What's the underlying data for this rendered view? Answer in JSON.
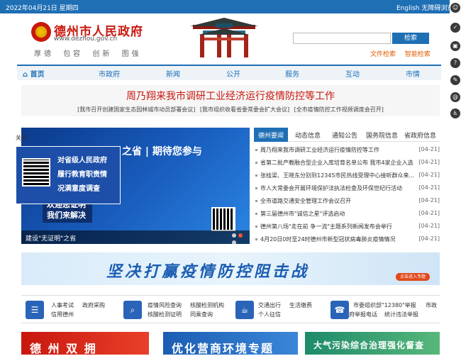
{
  "topbar": {
    "date": "2022年04月21日 星期四",
    "lang": "English",
    "access": "无障碍浏览"
  },
  "header": {
    "title": "德州市人民政府",
    "url": "www.dezhou.gov.cn",
    "slogans": [
      "厚德",
      "包容",
      "创新",
      "图强"
    ],
    "search_placeholder": "",
    "search_button": "检索",
    "links": [
      "文件检索",
      "智能检索"
    ]
  },
  "nav": [
    "首页",
    "市政府",
    "新闻",
    "公开",
    "服务",
    "互动",
    "市情"
  ],
  "headline": {
    "title": "周乃翔来我市调研工业经济运行疫情防控等工作",
    "subs": [
      "[我市召开创建国家生态园林城市动员部署会议]",
      "[我市组织收看省委常委会扩大会议]",
      "[全市疫情防控工作视频调度会召开]"
    ]
  },
  "slider": {
    "bigtext": "之省 | 期待您参与",
    "button_text": [
      "欢迎您证明",
      "我们来解决"
    ],
    "caption": "建设\"无证明\"之省",
    "arrow": "›"
  },
  "popup": {
    "lines": [
      "对省级人民政府",
      "履行教育职责情",
      "况满意度调查"
    ],
    "close": "关闭"
  },
  "news": {
    "tabs": [
      "德州要闻",
      "动态信息",
      "通知公告",
      "国务院信息",
      "省政府信息"
    ],
    "items": [
      {
        "title": "周乃翔来我市调研工业经济运行疫情防控等工作",
        "date": "[04-21]"
      },
      {
        "title": "省第二批产教融合型企业入库培育名单公布 我市4家企业入选",
        "date": "[04-21]"
      },
      {
        "title": "张桂梁、王晓东分别到12345市民热线受理中心接听群众来...",
        "date": "[04-21]"
      },
      {
        "title": "市人大常委会开展环境保护法执法检查及环保世纪行活动",
        "date": "[04-21]"
      },
      {
        "title": "全市道路交通安全管理工作会议召开",
        "date": "[04-21]"
      },
      {
        "title": "第三届德州市\"诚信之星\"评选启动",
        "date": "[04-21]"
      },
      {
        "title": "德州第八场\"走在前 争一流\"主题系列新闻发布会举行",
        "date": "[04-21]"
      },
      {
        "title": "4月20日0时至24时德州市新型冠状病毒肺炎疫情情况",
        "date": "[04-21]"
      }
    ]
  },
  "banner": {
    "text": "坚决打赢疫情防控阻击战",
    "pill": "点击进入专题"
  },
  "services": [
    {
      "icon": "list-icon",
      "glyph": "☰",
      "rows": [
        [
          "人事考试",
          "政府采购"
        ],
        [
          "信用德州"
        ]
      ]
    },
    {
      "icon": "search-icon",
      "glyph": "⌕",
      "rows": [
        [
          "疫情风险查询",
          "核酸检测机构"
        ],
        [
          "核酸检测证明",
          "同乘查询"
        ]
      ]
    },
    {
      "icon": "coffee-icon",
      "glyph": "☕",
      "rows": [
        [
          "交通出行",
          "生活缴费"
        ],
        [
          "个人征信"
        ]
      ]
    },
    {
      "icon": "phone-icon",
      "glyph": "☎",
      "rows": [
        [
          "市委组织部\"12380\"举报",
          "市政"
        ],
        [
          "府举报电话",
          "统计违法举报"
        ]
      ]
    }
  ],
  "bottom_banners": [
    "德 州 双 拥",
    "优化营商环境专题",
    "大气污染综合治理强化督查"
  ],
  "colors": {
    "primary": "#1f6fb5",
    "accent": "#c8170e"
  }
}
